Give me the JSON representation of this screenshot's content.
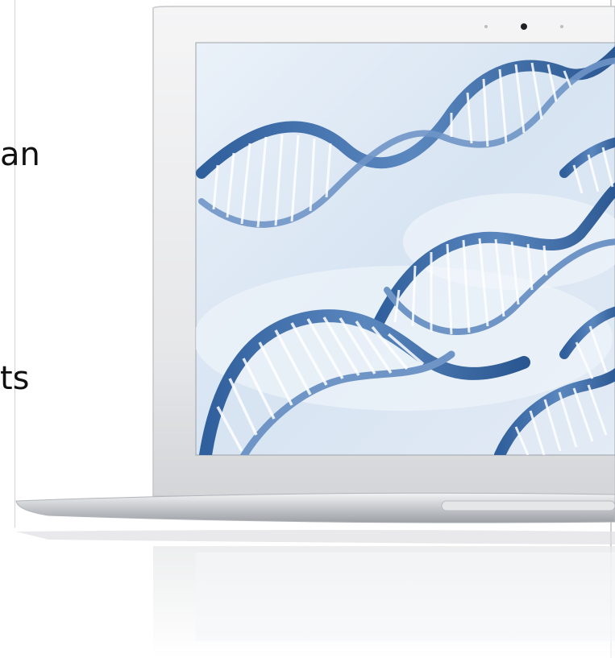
{
  "slide": {
    "text_fragments": [
      "an",
      "ts"
    ]
  },
  "image": {
    "subject": "laptop-displaying-dna-helices"
  },
  "colors": {
    "screen_bg": "#d9e6f3",
    "helix_blue": "#4a77ad",
    "bezel": "#e9eaec",
    "aluminum": "#c8cbcf"
  }
}
